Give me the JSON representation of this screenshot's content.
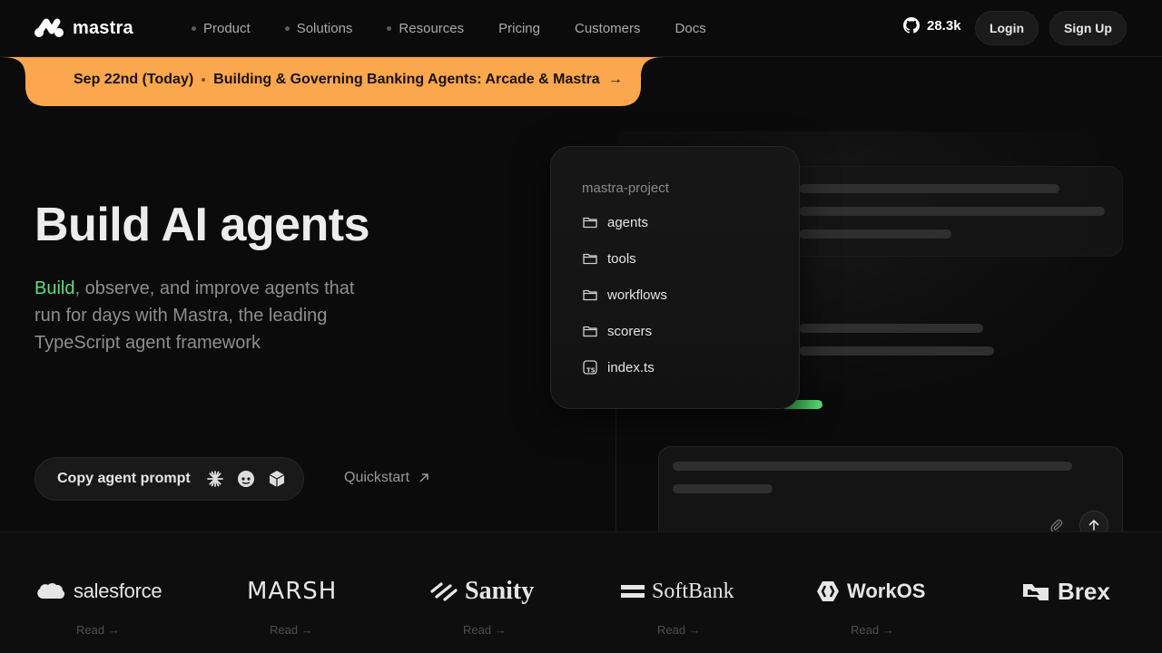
{
  "nav": {
    "brand": "mastra",
    "links": [
      {
        "label": "Product",
        "dot": true
      },
      {
        "label": "Solutions",
        "dot": true
      },
      {
        "label": "Resources",
        "dot": true
      },
      {
        "label": "Pricing",
        "dot": false
      },
      {
        "label": "Customers",
        "dot": false
      },
      {
        "label": "Docs",
        "dot": false
      }
    ],
    "github_stars": "28.3k",
    "login_label": "Login",
    "signup_label": "Sign Up"
  },
  "banner": {
    "date": "Sep 22nd (Today)",
    "title": "Building & Governing Banking Agents: Arcade & Mastra",
    "arrow": "→",
    "color": "#fba74d"
  },
  "hero": {
    "title": "Build AI agents",
    "subtitle_highlight": "Build",
    "subtitle_rest": ", observe, and improve agents that run for days with Mastra, the leading TypeScript agent framework",
    "copy_prompt_label": "Copy agent prompt",
    "quickstart_label": "Quickstart",
    "accent": "#5ee07a"
  },
  "project": {
    "title": "mastra-project",
    "items": [
      {
        "label": "agents",
        "icon": "folder-icon"
      },
      {
        "label": "tools",
        "icon": "folder-icon"
      },
      {
        "label": "workflows",
        "icon": "folder-icon"
      },
      {
        "label": "scorers",
        "icon": "folder-icon"
      },
      {
        "label": "index.ts",
        "icon": "typescript-file-icon"
      }
    ]
  },
  "customers": [
    {
      "name": "salesforce",
      "read": "Read →"
    },
    {
      "name": "MARSH",
      "read": "Read →"
    },
    {
      "name": "Sanity",
      "read": "Read →"
    },
    {
      "name": "SoftBank",
      "read": "Read →"
    },
    {
      "name": "WorkOS",
      "read": "Read →"
    },
    {
      "name": "Brex",
      "read": ""
    }
  ]
}
